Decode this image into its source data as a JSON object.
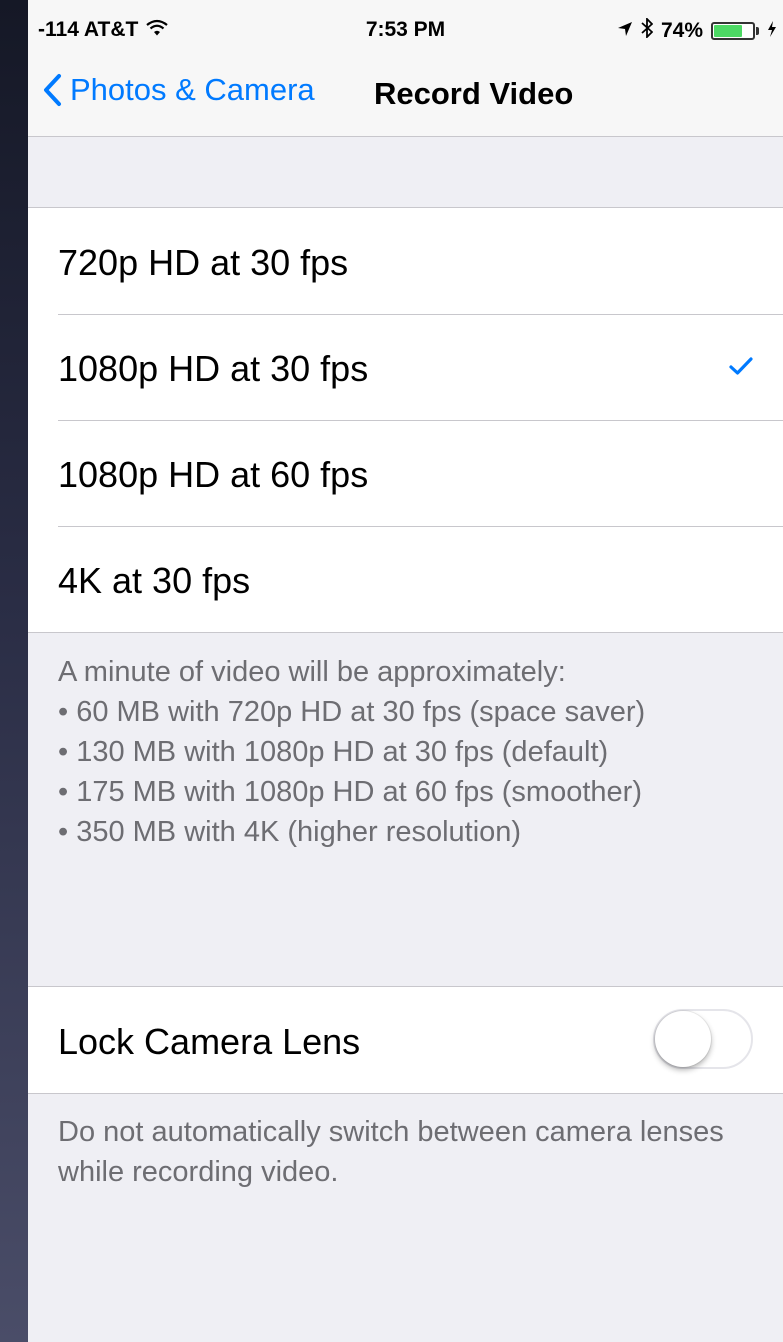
{
  "status_bar": {
    "carrier": "-114 AT&T",
    "time": "7:53 PM",
    "battery_text": "74%",
    "battery_level": 0.74
  },
  "nav": {
    "back_label": "Photos & Camera",
    "title": "Record Video"
  },
  "video_options": [
    {
      "label": "720p HD at 30 fps",
      "selected": false
    },
    {
      "label": "1080p HD at 30 fps",
      "selected": true
    },
    {
      "label": "1080p HD at 60 fps",
      "selected": false
    },
    {
      "label": "4K at 30 fps",
      "selected": false
    }
  ],
  "video_footer": {
    "intro": "A minute of video will be approximately:",
    "lines": [
      "• 60 MB with 720p HD at 30 fps (space saver)",
      "• 130 MB with 1080p HD at 30 fps (default)",
      "• 175 MB with 1080p HD at 60 fps (smoother)",
      "• 350 MB with 4K (higher resolution)"
    ]
  },
  "lock_lens": {
    "label": "Lock Camera Lens",
    "enabled": false,
    "footer": "Do not automatically switch between camera lenses while recording video."
  },
  "colors": {
    "accent": "#007aff",
    "battery": "#4cd964",
    "background": "#efeff4"
  }
}
